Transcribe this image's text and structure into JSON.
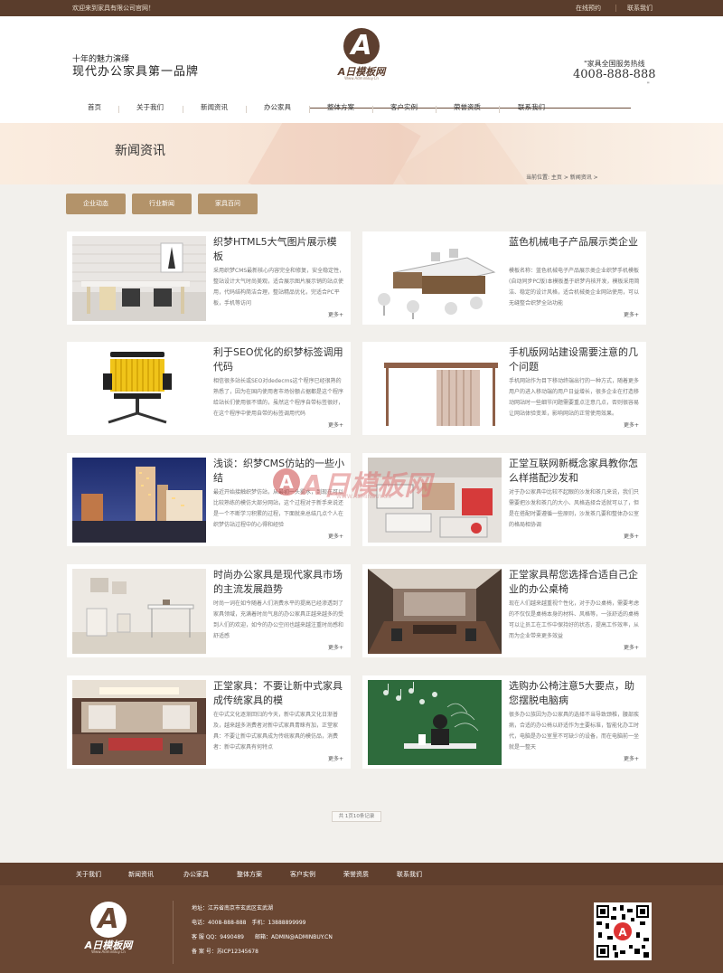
{
  "topbar": {
    "welcome": "欢迎来到家具有限公司官网！",
    "links": [
      "在线预约",
      "联系我们"
    ]
  },
  "header": {
    "slogan_small": "十年的魅力演绎",
    "slogan_big": "现代办公家具第一品牌",
    "logo_letter": "A",
    "logo_text": "A日模板网",
    "logo_sub": "Www.AdminBuy.Cn",
    "hotline_label": "\"家具全国服务热线",
    "hotline_number": "4008-888-888",
    "hotline_mark": "\""
  },
  "nav": [
    "首页",
    "关于我们",
    "新闻资讯",
    "办公家具",
    "整体方案",
    "客户实例",
    "荣誉资质",
    "联系我们"
  ],
  "banner": {
    "title": "新闻资讯",
    "breadcrumb": "当前位置: 主页 > 新闻资讯 >"
  },
  "categories": [
    "企业动态",
    "行业新闻",
    "家具百问"
  ],
  "articles": [
    {
      "title": "织梦HTML5大气图片展示模板",
      "desc": "采用织梦CMS最新核心内容完全和修复，安全稳定性，整站设计大气时尚美观，适合展示图片展示销的站点使用，代码结构简洁合理，整站精品优化，完适合PC平板，手机等访问",
      "more": "更多+"
    },
    {
      "title": "蓝色机械电子产品展示类企业",
      "desc": "模板名称：蓝色机械电子产品展示类企业织梦手机模板(自动同步PC版)本模板基于织梦内核开发，模板采用简洁、稳定的设计风格，适合机械类企业网站使用，可以无缝整合织梦全站功能",
      "more": "更多+"
    },
    {
      "title": "利于SEO优化的织梦标签调用代码",
      "desc": "相信很多站长或SEO对dedecms这个程序已经很熟的熟悉了，因为在国内使用者市场份额占据都是这个程序给站长们使用很不错的，虽然这个程序自带标签很好，在这个程序中使用自带的标签调用代码",
      "more": "更多+"
    },
    {
      "title": "手机版网站建设需要注意的几个问题",
      "desc": "手机网站作为目下移动终端出行的一种方式，随着更多用户的进入移动端的用户日益增长，很多企业在打造移动网站时一些细节问题需要重点注意几点，否则很容易让网站体验变差，影响网站的正常使用效果。",
      "more": "更多+"
    },
    {
      "title": "浅谈：织梦CMS仿站的一些小结",
      "desc": "最近开始接触织梦仿站，从最初一头雾水，到现在可以比较熟练的模仿大部分网站，这个过程对于新手来说还是一个不断学习积累的过程，下面就来总结几点个人在织梦仿站过程中的心得和经验",
      "more": "更多+"
    },
    {
      "title": "正堂互联网新概念家具教你怎么样搭配沙发和",
      "desc": "对于办公家具中比较不起眼的沙发和茶几来说，我们只需要把沙发和茶几的大小、风格选择合适就可以了，但是在搭配时要遵循一些原则，沙发茶几要和整体办公室的格局相协调",
      "more": "更多+"
    },
    {
      "title": "时尚办公家具是现代家具市场的主流发展趋势",
      "desc": "时尚一词在如今随着人们消费水平的提高已经渗透到了家具领域，充满着时尚气息的办公家具正越来越多的受到人们的欢迎，如今的办公空间也越来越注重时尚感和舒适感",
      "more": "更多+"
    },
    {
      "title": "正堂家具帮您选择合适自己企业的办公桌椅",
      "desc": "现在人们越来越重视个性化，对于办公桌椅，需要考虑的不仅仅是桌椅本身的材料、风格等，一张舒适的桌椅可以让员工在工作中保持好的状态，提高工作效率，从而为企业带来更多效益",
      "more": "更多+"
    },
    {
      "title": "正堂家具：不要让新中式家具成传统家具的模",
      "desc": "在中式文化逐渐回归的今天，新中式家具文化日渐普及，越来越多消费者对新中式家具青睐有加，正堂家具：不要让新中式家具成为传统家具的模仿品，消费者：新中式家具有何特点",
      "more": "更多+"
    },
    {
      "title": "选购办公椅注意5大要点，助您摆脱电脑病",
      "desc": "很多办公族因为办公家具的选择不当导致颈椎，腰部疾病，合适的办公椅以舒适作为主要标准，智能化办工时代，电脑是办公室里不可缺少的设备，而在电脑前一坐就是一整天",
      "more": "更多+"
    }
  ],
  "pager": "共 1页10条记录",
  "footer_nav": [
    "关于我们",
    "新闻资讯",
    "办公家具",
    "整体方案",
    "客户实例",
    "荣誉资质",
    "联系我们"
  ],
  "footer": {
    "address": "地址：江苏省南京市玄武区玄武湖",
    "phone": "电话：4008-888-888　手机：13888899999",
    "qq": "客 服 QQ：9490489　　邮箱：ADMIN@ADMINBUY.CN",
    "icp": "备 案 号：苏ICP12345678",
    "logo_letter": "A",
    "logo_text": "A日模板网",
    "logo_sub": "Www.AdminBuy.Cn"
  },
  "watermark": {
    "letter": "A",
    "text": "A日模板网",
    "sub": "WWW.ADMINBUY.CN"
  },
  "colors": {
    "brown": "#603f2d",
    "gold": "#b3936a",
    "bg": "#f2f0ec"
  }
}
